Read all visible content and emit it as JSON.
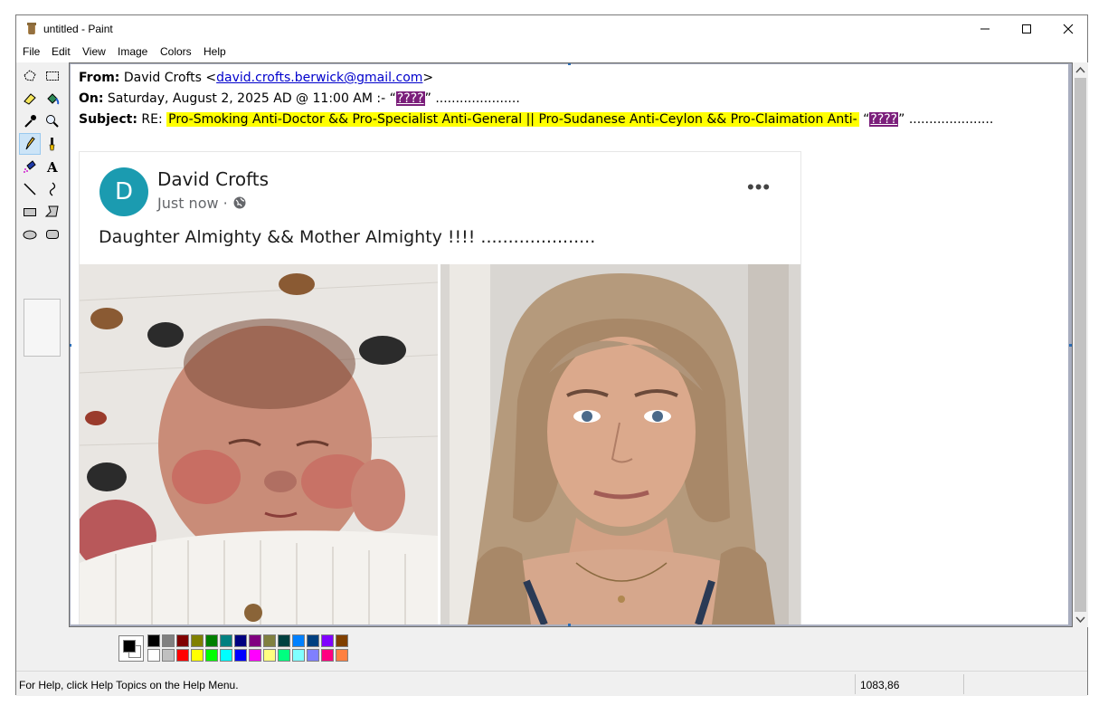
{
  "window": {
    "title": "untitled - Paint",
    "controls": [
      "minimize",
      "maximize",
      "close"
    ]
  },
  "menubar": {
    "items": [
      "File",
      "Edit",
      "View",
      "Image",
      "Colors",
      "Help"
    ]
  },
  "toolbox": {
    "tools": [
      {
        "name": "free-form-select",
        "icon": "free-select-icon"
      },
      {
        "name": "select",
        "icon": "rect-select-icon"
      },
      {
        "name": "eraser",
        "icon": "eraser-icon"
      },
      {
        "name": "fill",
        "icon": "fill-bucket-icon"
      },
      {
        "name": "pick-color",
        "icon": "eyedropper-icon"
      },
      {
        "name": "magnifier",
        "icon": "magnifier-icon"
      },
      {
        "name": "pencil",
        "icon": "pencil-icon",
        "selected": true
      },
      {
        "name": "brush",
        "icon": "brush-icon"
      },
      {
        "name": "airbrush",
        "icon": "airbrush-icon"
      },
      {
        "name": "text",
        "icon": "text-icon"
      },
      {
        "name": "line",
        "icon": "line-icon"
      },
      {
        "name": "curve",
        "icon": "curve-icon"
      },
      {
        "name": "rectangle",
        "icon": "rectangle-icon"
      },
      {
        "name": "polygon",
        "icon": "polygon-icon"
      },
      {
        "name": "ellipse",
        "icon": "ellipse-icon"
      },
      {
        "name": "rounded-rectangle",
        "icon": "rounded-rect-icon"
      }
    ]
  },
  "email": {
    "from_label": "From:",
    "from_name": "David Crofts <",
    "from_email": "david.crofts.berwick@gmail.com",
    "from_close": ">",
    "on_label": "On:",
    "on_text": "Saturday, August 2, 2025 AD @ 11:00 AM :- “",
    "on_mark": "????",
    "on_tail": "” .....................",
    "subject_label": "Subject:",
    "subject_prefix": "RE: ",
    "subject_highlight": "Pro-Smoking Anti-Doctor && Pro-Specialist Anti-General || Pro-Sudanese Anti-Ceylon && Pro-Claimation Anti-",
    "subject_open": " “",
    "subject_mark": "????",
    "subject_tail": "” ....................."
  },
  "post": {
    "avatar_letter": "D",
    "author": "David Crofts",
    "time": "Just now ·",
    "more": "•••",
    "text": "Daughter Almighty && Mother Almighty !!!! ....................."
  },
  "palette": {
    "foreground": "#000000",
    "background": "#ffffff",
    "row1": [
      "#000000",
      "#808080",
      "#800000",
      "#808000",
      "#008000",
      "#008080",
      "#000080",
      "#800080",
      "#808040",
      "#004040",
      "#0080ff",
      "#004080",
      "#8000ff",
      "#804000"
    ],
    "row2": [
      "#ffffff",
      "#c0c0c0",
      "#ff0000",
      "#ffff00",
      "#00ff00",
      "#00ffff",
      "#0000ff",
      "#ff00ff",
      "#ffff80",
      "#00ff80",
      "#80ffff",
      "#8080ff",
      "#ff0080",
      "#ff8040"
    ]
  },
  "statusbar": {
    "help_text": "For Help, click Help Topics on the Help Menu.",
    "coords": "1083,86"
  }
}
